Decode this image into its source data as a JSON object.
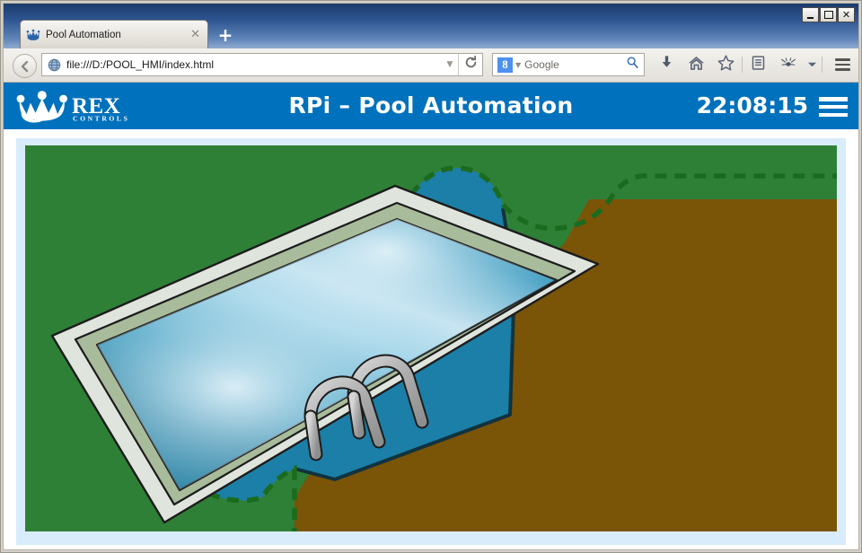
{
  "browser": {
    "window_controls": [
      {
        "name": "minimize",
        "glyph": "_"
      },
      {
        "name": "maximize",
        "glyph": "□"
      },
      {
        "name": "close",
        "glyph": "✕"
      }
    ],
    "tab": {
      "title": "Pool Automation",
      "favicon": "rex-crown-icon",
      "close_glyph": "✕"
    },
    "new_tab_glyph": "+",
    "back_icon": "back-arrow-icon",
    "address_bar": {
      "icon": "globe-icon",
      "url": "file:///D:/POOL_HMI/index.html",
      "dropdown_glyph": "▼",
      "reload_icon": "reload-icon"
    },
    "search_bar": {
      "engine_badge": "8",
      "engine_caret": "▼",
      "placeholder": "Google",
      "submit_icon": "magnifier-icon"
    },
    "toolbar_icons": [
      "download-icon",
      "home-icon",
      "bookmark-star-icon",
      "library-icon",
      "addon-icon",
      "chevron-down-icon"
    ],
    "menu_icon": "hamburger-menu-icon"
  },
  "app": {
    "brand": {
      "name": "REX",
      "subtitle": "CONTROLS",
      "logo_icon": "rex-crown-logo"
    },
    "title": "RPi – Pool Automation",
    "clock": "22:08:15",
    "menu_icon": "hamburger-menu-icon",
    "colors": {
      "header_blue": "#0071bc",
      "panel_blue": "#d8ecfb",
      "lawn_green": "#2f8037",
      "soil_brown": "#7a5407",
      "pond_blue": "#1b7fa8",
      "pond_outline": "#1b6b1f",
      "coping_white": "#dfe5dd",
      "wall_sage": "#a8bb9a",
      "water_light": "#cfe6f2",
      "water_deep": "#0d6e96",
      "ladder_steel": "#b3b3b3"
    },
    "scene": {
      "name": "pool-overview-graphic",
      "elements": [
        "lawn",
        "soil-area",
        "natural-pond",
        "swimming-pool",
        "pool-coping",
        "pool-water",
        "pool-ladder"
      ]
    }
  }
}
